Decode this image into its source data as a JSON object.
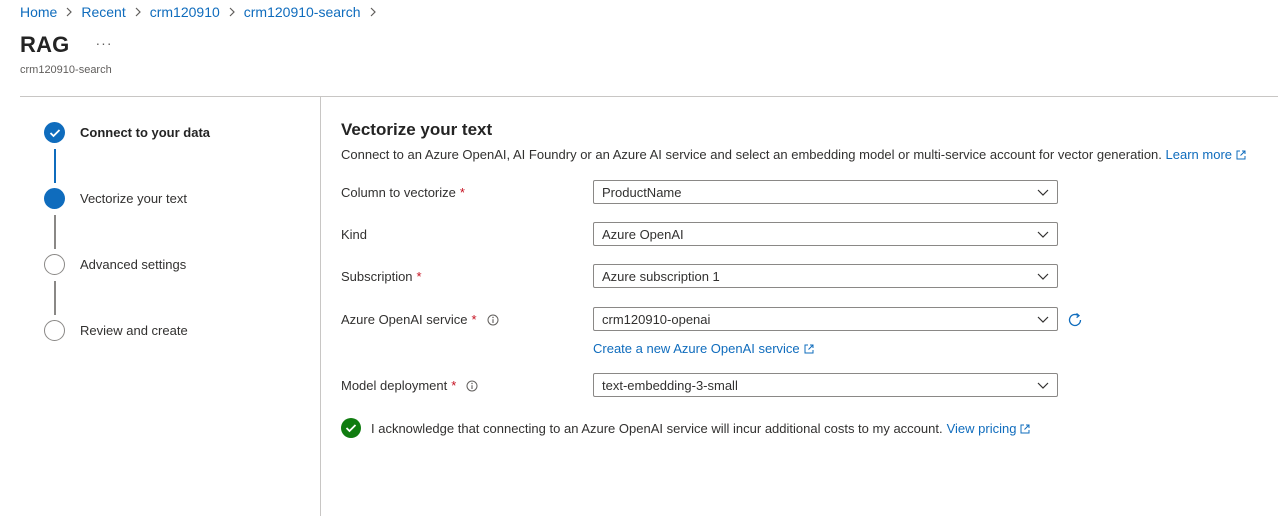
{
  "breadcrumb": {
    "items": [
      "Home",
      "Recent",
      "crm120910",
      "crm120910-search"
    ]
  },
  "header": {
    "title": "RAG",
    "more": "···",
    "subtitle": "crm120910-search"
  },
  "wizard": {
    "steps": [
      {
        "label": "Connect to your data",
        "state": "complete"
      },
      {
        "label": "Vectorize your text",
        "state": "current"
      },
      {
        "label": "Advanced settings",
        "state": "pending"
      },
      {
        "label": "Review and create",
        "state": "pending"
      }
    ]
  },
  "main": {
    "title": "Vectorize your text",
    "description": "Connect to an Azure OpenAI, AI Foundry or an Azure AI service and select an embedding model or multi-service account for vector generation.",
    "learn_more": "Learn more",
    "fields": {
      "column": {
        "label": "Column to vectorize",
        "required": "*",
        "value": "ProductName"
      },
      "kind": {
        "label": "Kind",
        "value": "Azure OpenAI"
      },
      "subscription": {
        "label": "Subscription",
        "required": "*",
        "value": "Azure subscription 1"
      },
      "service": {
        "label": "Azure OpenAI service",
        "required": "*",
        "value": "crm120910-openai"
      },
      "model": {
        "label": "Model deployment",
        "required": "*",
        "value": "text-embedding-3-small"
      }
    },
    "create_service_link": "Create a new Azure OpenAI service",
    "acknowledge": {
      "text": "I acknowledge that connecting to an Azure OpenAI service will incur additional costs to my account.",
      "link": "View pricing",
      "checked": true
    }
  },
  "colors": {
    "accent": "#0f6cbd",
    "success": "#107c10",
    "required": "#c50f1f"
  }
}
